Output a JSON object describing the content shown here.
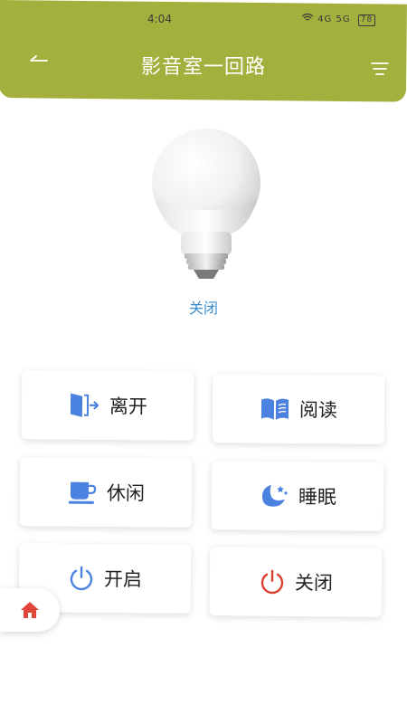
{
  "status_bar": {
    "time": "4:04",
    "network": "4G 5G",
    "battery": "78"
  },
  "header": {
    "title": "影音室一回路"
  },
  "bulb": {
    "state": "关闭"
  },
  "scenes": {
    "leave": "离开",
    "read": "阅读",
    "relax": "休闲",
    "sleep": "睡眠",
    "on": "开启",
    "off": "关闭"
  },
  "colors": {
    "header_bg": "#a4b03e",
    "accent_blue": "#3a8ed0",
    "icon_blue": "#4b82e0",
    "off_red": "#d9412f",
    "home_red": "#e0453a"
  },
  "icons": {
    "back": "back-arrow-icon",
    "menu": "menu-icon",
    "leave": "door-exit-icon",
    "read": "book-icon",
    "relax": "cup-icon",
    "sleep": "moon-icon",
    "on": "power-icon",
    "off": "power-icon",
    "home": "home-icon"
  }
}
